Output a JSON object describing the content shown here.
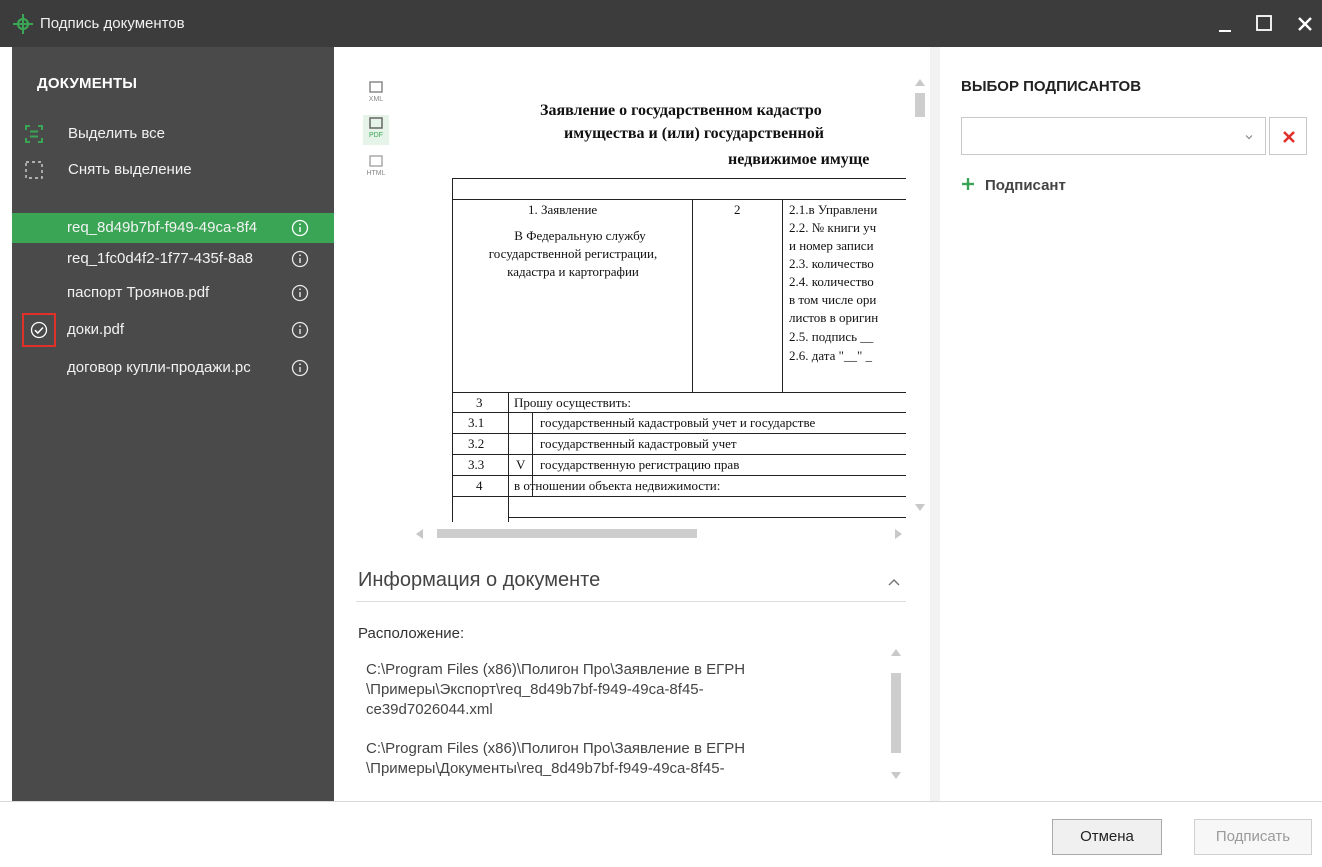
{
  "window": {
    "title": "Подпись документов"
  },
  "colors": {
    "accent": "#3aa655",
    "sidebar_bg": "#4a4a4a",
    "titlebar_bg": "#3c3c3c",
    "remove_red": "#e0302a"
  },
  "sidebar": {
    "heading": "ДОКУМЕНТЫ",
    "select_all": "Выделить все",
    "deselect": "Снять выделение",
    "documents": [
      {
        "label": "req_8d49b7bf-f949-49ca-8f4",
        "active": true,
        "checked": false
      },
      {
        "label": "req_1fc0d4f2-1f77-435f-8a8",
        "active": false,
        "checked": false
      },
      {
        "label": "паспорт Троянов.pdf",
        "active": false,
        "checked": false
      },
      {
        "label": "доки.pdf",
        "active": false,
        "checked": true
      },
      {
        "label": "договор купли-продажи.рс",
        "active": false,
        "checked": false
      }
    ]
  },
  "formats": [
    {
      "label": "XML",
      "active": false
    },
    {
      "label": "PDF",
      "active": true
    },
    {
      "label": "HTML",
      "active": false
    }
  ],
  "preview": {
    "title_lines": [
      "Заявление о государственном кадастро",
      "имущества и (или) государственной",
      "недвижимое имуще"
    ],
    "sec1_label": "1. Заявление",
    "sec1_text": [
      "В Федеральную службу",
      "государственной регистрации,",
      "кадастра и картографии"
    ],
    "sec2_label": "2",
    "sec2_text": [
      "2.1.в Управлени",
      "2.2. № книги уч",
      "и номер записи",
      "2.3. количество",
      "2.4. количество",
      "в том числе ори",
      "листов в оригин",
      "2.5. подпись __",
      "2.6. дата \"__\" _"
    ],
    "sec3_num": "3",
    "sec3_text": "Прошу осуществить:",
    "rows": [
      {
        "num": "3.1",
        "mark": "",
        "text": "государственный кадастровый учет и государстве"
      },
      {
        "num": "3.2",
        "mark": "",
        "text": "государственный кадастровый учет"
      },
      {
        "num": "3.3",
        "mark": "V",
        "text": "государственную регистрацию прав"
      }
    ],
    "sec4_num": "4",
    "sec4_text": "в отношении объекта недвижимости:"
  },
  "info": {
    "title": "Информация о документе",
    "location_label": "Расположение:",
    "paths": [
      [
        "C:\\Program Files (x86)\\Полигон Про\\Заявление в ЕГРН",
        "\\Примеры\\Экспорт\\req_8d49b7bf-f949-49ca-8f45-",
        "ce39d7026044.xml"
      ],
      [
        "C:\\Program Files (x86)\\Полигон Про\\Заявление в ЕГРН",
        "\\Примеры\\Документы\\req_8d49b7bf-f949-49ca-8f45-"
      ]
    ]
  },
  "signers": {
    "heading": "ВЫБОР ПОДПИСАНТОВ",
    "selected": "",
    "add_label": "Подписант"
  },
  "footer": {
    "cancel": "Отмена",
    "sign": "Подписать"
  }
}
